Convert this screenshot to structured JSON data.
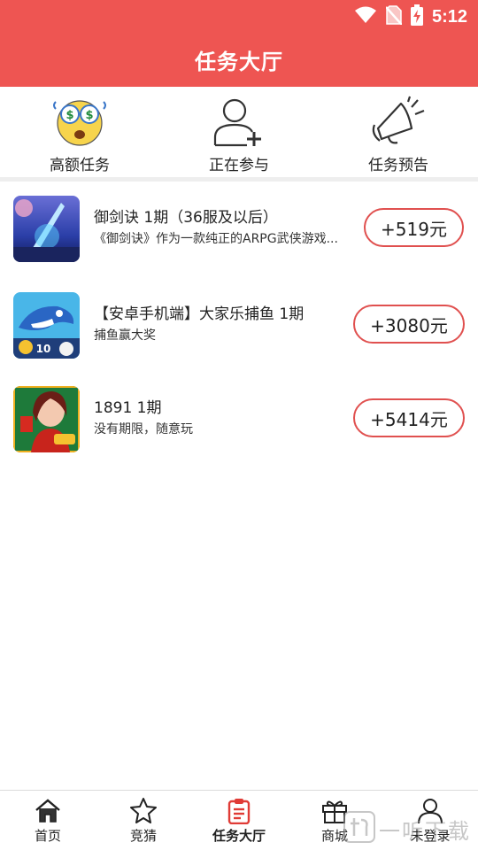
{
  "status": {
    "time": "5:12"
  },
  "header": {
    "title": "任务大厅"
  },
  "categories": [
    {
      "label": "高额任务",
      "icon": "money-eyes-emoji-icon"
    },
    {
      "label": "正在参与",
      "icon": "user-add-icon"
    },
    {
      "label": "任务预告",
      "icon": "megaphone-icon"
    }
  ],
  "tasks": [
    {
      "title": "御剑诀 1期（36服及以后）",
      "subtitle": "《御剑诀》作为一款纯正的ARPG武侠游戏...",
      "reward": "+519元"
    },
    {
      "title": "【安卓手机端】大家乐捕鱼 1期",
      "subtitle": "捕鱼赢大奖",
      "reward": "+3080元"
    },
    {
      "title": "1891 1期",
      "subtitle": "没有期限，随意玩",
      "reward": "+5414元"
    }
  ],
  "nav": [
    {
      "label": "首页",
      "icon": "home-icon"
    },
    {
      "label": "竞猜",
      "icon": "guess-star-icon",
      "badge": "竞猜"
    },
    {
      "label": "任务大厅",
      "icon": "task-clipboard-icon",
      "active": true
    },
    {
      "label": "商城",
      "icon": "gift-icon"
    },
    {
      "label": "未登录",
      "icon": "user-icon"
    }
  ],
  "watermark": {
    "text": "一听下载"
  },
  "colors": {
    "brand": "#ee5552",
    "reward_border": "#e0504f"
  }
}
